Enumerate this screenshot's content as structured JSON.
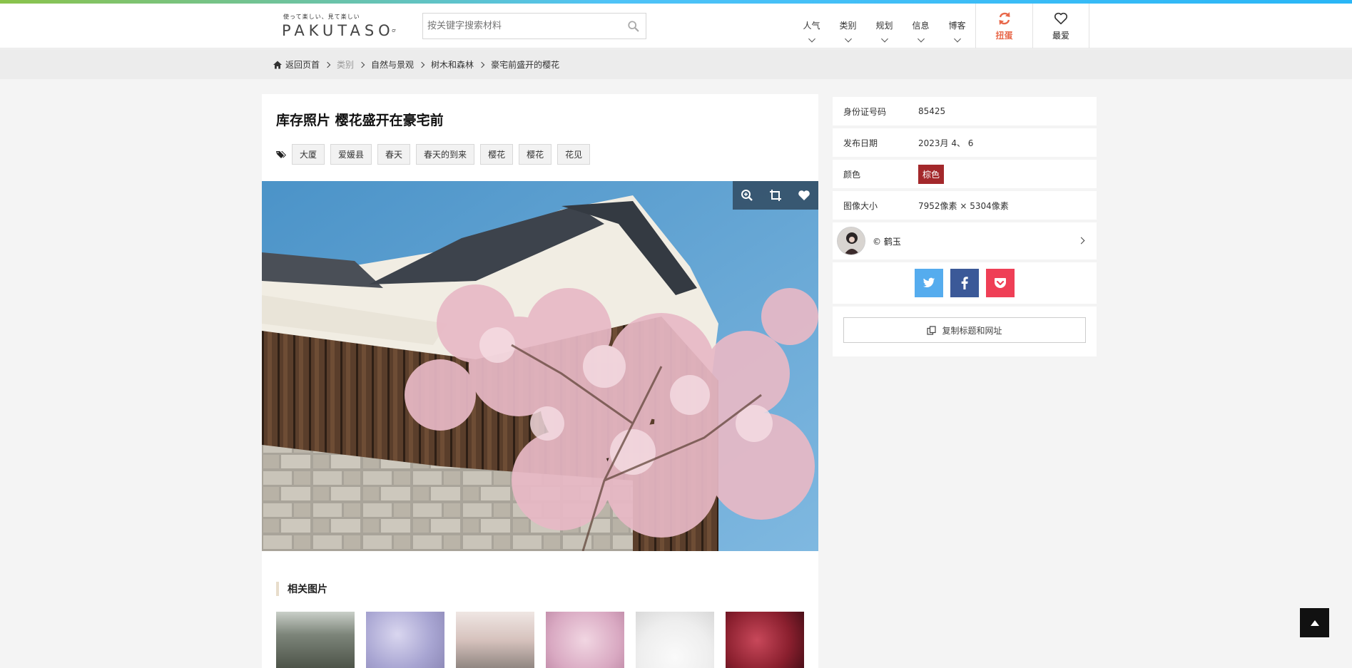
{
  "header": {
    "logo_tagline": "使って楽しい、見て楽しい",
    "logo_text": "PAKUTASO",
    "search_placeholder": "按关键字搜索材料",
    "nav": [
      {
        "label": "人气"
      },
      {
        "label": "类别"
      },
      {
        "label": "规划"
      },
      {
        "label": "信息"
      },
      {
        "label": "博客"
      }
    ],
    "shuffle_label": "扭蛋",
    "favorites_label": "最爱"
  },
  "breadcrumb": {
    "home": "返回页首",
    "items": [
      "类别",
      "自然与景观",
      "树木和森林",
      "豪宅前盛开的樱花"
    ]
  },
  "photo": {
    "title": "库存照片 樱花盛开在豪宅前",
    "tags": [
      "大厦",
      "爱媛县",
      "春天",
      "春天的到来",
      "樱花",
      "樱花",
      "花见"
    ]
  },
  "related": {
    "title": "相关图片"
  },
  "info": {
    "id_label": "身份证号码",
    "id_value": "85425",
    "date_label": "发布日期",
    "date_value": "2023月 4、 6",
    "color_label": "颜色",
    "color_value": "棕色",
    "size_label": "图像大小",
    "size_value": "7952像素 × 5304像素",
    "author": "© 鹤玉",
    "copy_label": "复制标题和网址"
  },
  "colors": {
    "accent": "#e8684a",
    "color_chip": "#a3282b",
    "twitter": "#55acee",
    "facebook": "#3b5998",
    "pocket": "#ef3f56"
  }
}
